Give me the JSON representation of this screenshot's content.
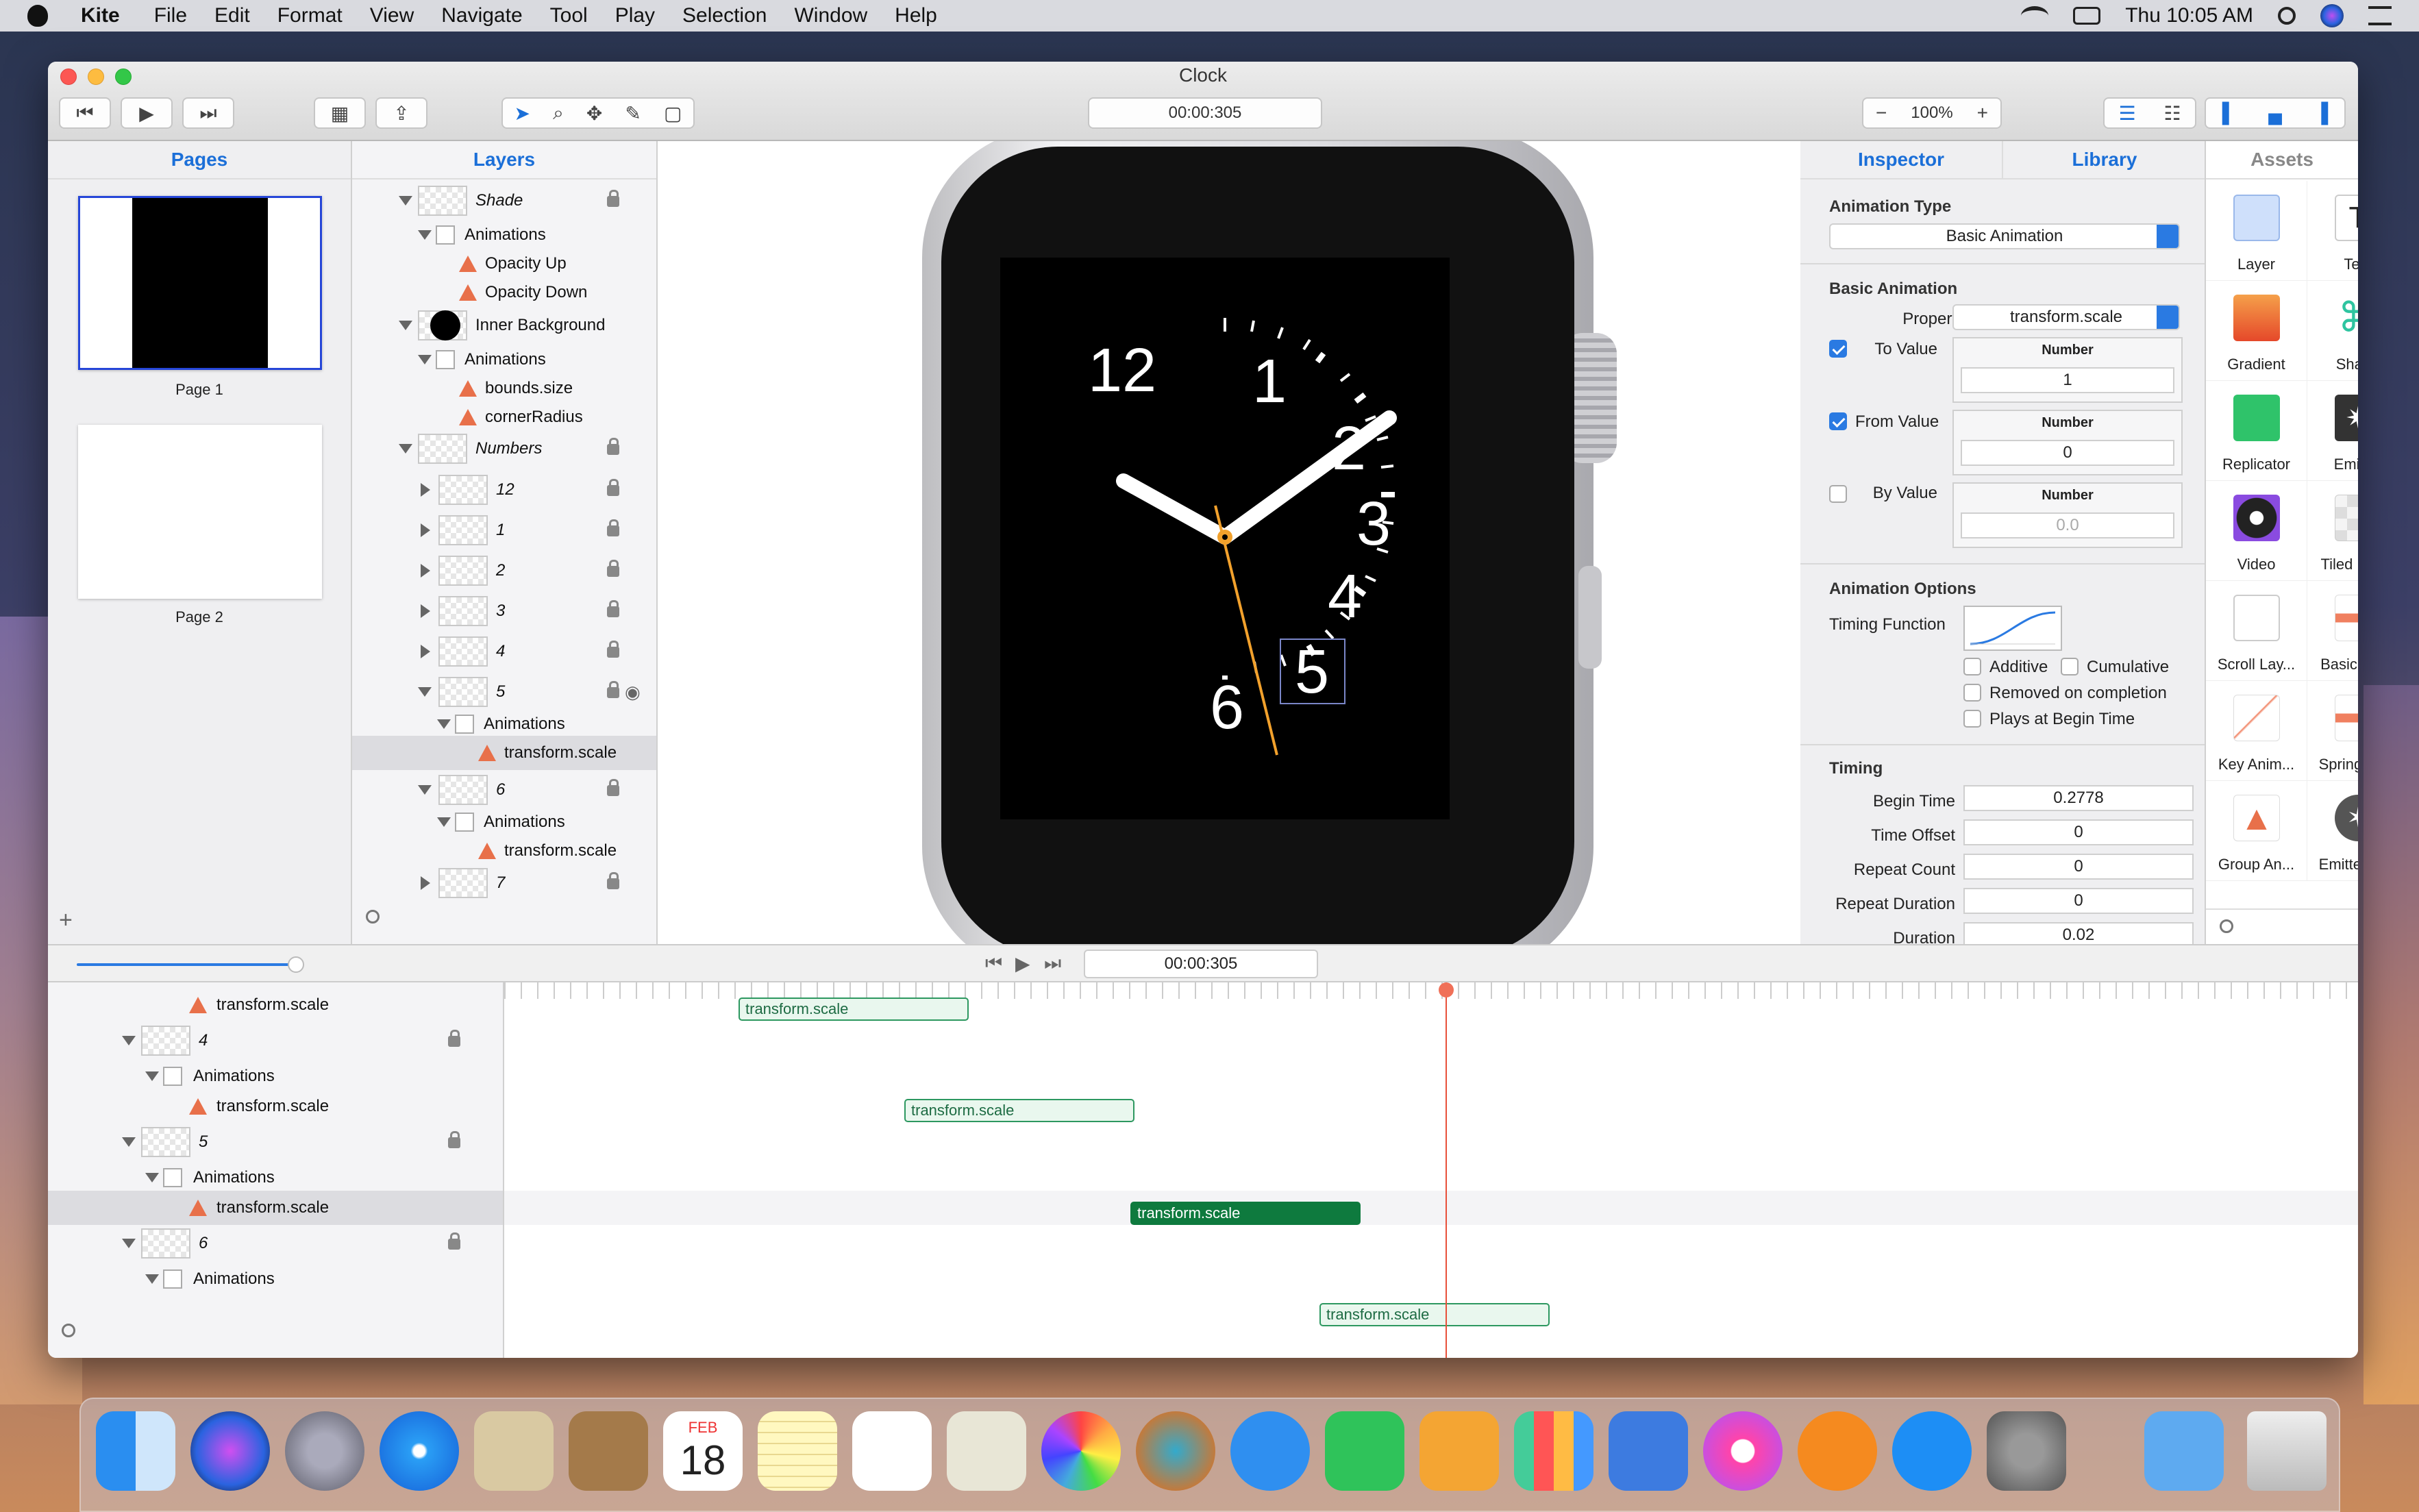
{
  "menubar": {
    "app": "Kite",
    "items": [
      "File",
      "Edit",
      "Format",
      "View",
      "Navigate",
      "Tool",
      "Play",
      "Selection",
      "Window",
      "Help"
    ],
    "clock": "Thu 10:05 AM"
  },
  "window": {
    "title": "Clock",
    "timecode": "00:00:305",
    "zoom": "100%",
    "zoom_minus": "−",
    "zoom_plus": "+"
  },
  "pages": {
    "title": "Pages",
    "items": [
      "Page 1",
      "Page 2"
    ],
    "add": "+"
  },
  "layers": {
    "title": "Layers",
    "rows": [
      "Shade",
      "Animations",
      "Opacity Up",
      "Opacity Down",
      "Inner Background",
      "Animations",
      "bounds.size",
      "cornerRadius",
      "Numbers",
      "12",
      "1",
      "2",
      "3",
      "4",
      "5",
      "Animations",
      "transform.scale",
      "6",
      "Animations",
      "transform.scale",
      "7"
    ]
  },
  "watch": {
    "numbers": [
      "12",
      "1",
      "2",
      "3",
      "4",
      "5",
      "6"
    ]
  },
  "inspector": {
    "tabs": [
      "Inspector",
      "Library"
    ],
    "animation_type_label": "Animation Type",
    "animation_type": "Basic Animation",
    "basic_title": "Basic Animation",
    "property_label": "Property",
    "property": "transform.scale",
    "to_label": "To Value",
    "to_type": "Number",
    "to_value": "1",
    "from_label": "From Value",
    "from_type": "Number",
    "from_value": "0",
    "by_label": "By Value",
    "by_type": "Number",
    "by_value": "0.0",
    "options_title": "Animation Options",
    "timing_function": "Timing Function",
    "additive": "Additive",
    "cumulative": "Cumulative",
    "removed": "Removed on completion",
    "plays": "Plays at Begin Time",
    "timing_title": "Timing",
    "begin_label": "Begin Time",
    "begin": "0.2778",
    "offset_label": "Time Offset",
    "offset": "0",
    "repeat_label": "Repeat Count",
    "repeat": "0",
    "repdur_label": "Repeat Duration",
    "repdur": "0",
    "duration_label": "Duration",
    "duration": "0.02"
  },
  "assets": {
    "title": "Assets",
    "items": [
      "Layer",
      "Text",
      "Gradient",
      "Shape",
      "Replicator",
      "Emitter",
      "Video",
      "Tiled Layer",
      "Scroll Lay...",
      "Basic Ani...",
      "Key Anim...",
      "Spring An...",
      "Group An...",
      "Emitter Cell"
    ]
  },
  "timeline": {
    "timecode": "00:00:305",
    "rows": [
      "transform.scale",
      "4",
      "Animations",
      "transform.scale",
      "5",
      "Animations",
      "transform.scale",
      "6",
      "Animations"
    ],
    "clips": [
      "transform.scale",
      "transform.scale",
      "transform.scale",
      "transform.scale"
    ]
  },
  "dock": {
    "calendar_month": "FEB",
    "calendar_day": "18"
  }
}
